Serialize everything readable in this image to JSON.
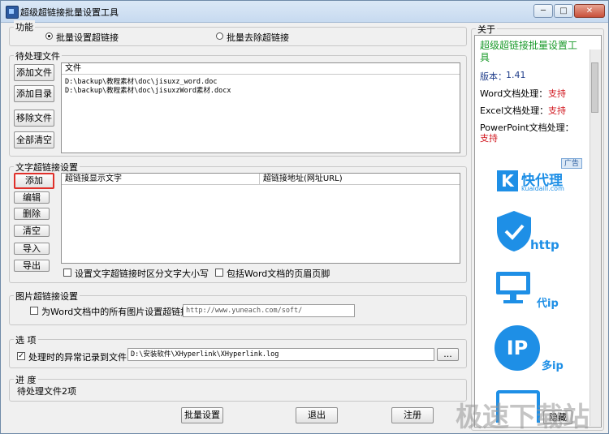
{
  "window": {
    "title": "超级超链接批量设置工具",
    "minimize": "─",
    "maximize": "□",
    "close": "✕"
  },
  "function": {
    "legend": "功能",
    "option_set": "批量设置超链接",
    "option_remove": "批量去除超链接",
    "selected": "批量设置超链接"
  },
  "pending": {
    "legend": "待处理文件",
    "buttons": [
      "添加文件",
      "添加目录",
      "移除文件",
      "全部清空"
    ],
    "column": "文件",
    "files": [
      "D:\\backup\\教程素材\\doc\\jisuxz_word.doc",
      "D:\\backup\\教程素材\\doc\\jisuxzWord素材.docx"
    ]
  },
  "text_link": {
    "legend": "文字超链接设置",
    "buttons": [
      "添加",
      "编辑",
      "删除",
      "清空",
      "导入",
      "导出"
    ],
    "col_text": "超链接显示文字",
    "col_url": "超链接地址(网址URL)",
    "case_sensitive": "设置文字超链接时区分文字大小写",
    "include_header_footer": "包括Word文档的页眉页脚"
  },
  "image_link": {
    "legend": "图片超链接设置",
    "checkbox_label": "为Word文档中的所有图片设置超链接:",
    "url_placeholder": "http://www.yuneach.com/soft/"
  },
  "options": {
    "legend": "选  项",
    "log_label": "处理时的异常记录到文件:",
    "log_path": "D:\\安装软件\\XHyperlink\\XHyperlink.log",
    "browse": "..."
  },
  "progress": {
    "legend": "进  度",
    "status": "待处理文件2项"
  },
  "bottom": {
    "batch": "批量设置",
    "exit": "退出",
    "register": "注册"
  },
  "about": {
    "legend": "关于",
    "title": "超级超链接批量设置工具",
    "version_label": "版本：",
    "version": "1.41",
    "word_label": "Word文档处理：",
    "word_status": "支持",
    "excel_label": "Excel文档处理：",
    "excel_status": "支持",
    "ppt_label": "PowerPoint文档处理：",
    "ppt_status": "支持",
    "ad_badge": "广告",
    "ad_logo": "快代理",
    "ad_domain": "kuaidaili.com",
    "ad_http": "http",
    "ad_dtip": "代ip",
    "ad_ip": "IP",
    "ad_multi_ip": "多ip",
    "hide_button": "隐藏"
  },
  "watermark": "极速下载站",
  "colors": {
    "accent_green": "#1a9a2a",
    "status_red": "#d0141c",
    "ad_blue": "#1e8fe6"
  }
}
